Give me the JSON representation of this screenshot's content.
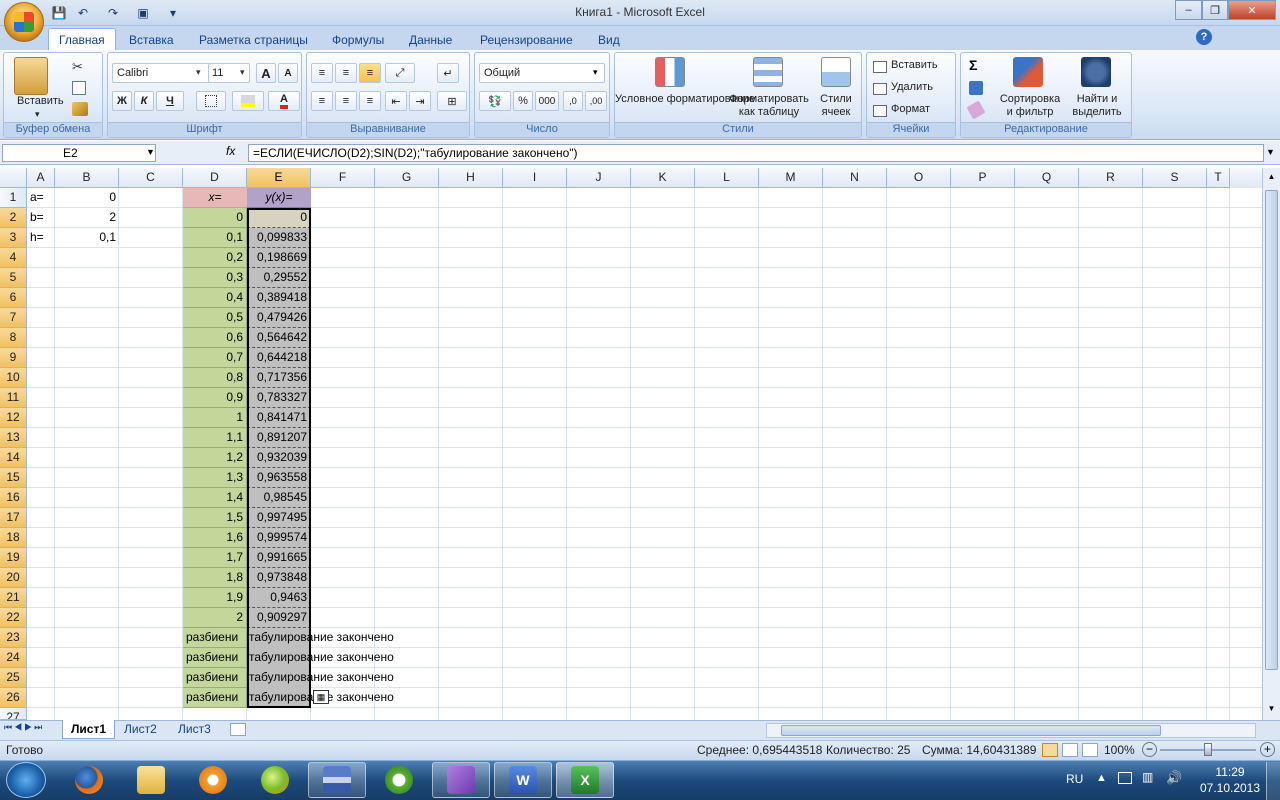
{
  "window": {
    "title": "Книга1 - Microsoft Excel",
    "min": "–",
    "restore": "❐",
    "close": "✕"
  },
  "qat": {
    "save": "💾",
    "undo": "↶",
    "redo": "↷",
    "preview": "▣",
    "dropdown": "▾"
  },
  "tabs": [
    "Главная",
    "Вставка",
    "Разметка страницы",
    "Формулы",
    "Данные",
    "Рецензирование",
    "Вид"
  ],
  "help": "?",
  "ribbon": {
    "clipboard": {
      "name": "Буфер обмена",
      "paste": "Вставить"
    },
    "font": {
      "name": "Шрифт",
      "family": "Calibri",
      "size": "11",
      "grow": "A",
      "shrink": "A",
      "bold": "Ж",
      "italic": "К",
      "underline": "Ч"
    },
    "alignment": {
      "name": "Выравнивание"
    },
    "number": {
      "name": "Число",
      "format": "Общий",
      "percent": "%",
      "thousands": "000",
      "incdec": ",0",
      "decdec": ",00"
    },
    "styles": {
      "name": "Стили",
      "conditional": "Условное форматирование",
      "as_table": "Форматировать как таблицу",
      "cell_styles": "Стили ячеек"
    },
    "cells": {
      "name": "Ячейки",
      "insert": "Вставить",
      "delete": "Удалить",
      "format": "Формат"
    },
    "editing": {
      "name": "Редактирование",
      "sum": "Σ",
      "sort": "Сортировка и фильтр",
      "find": "Найти и выделить"
    }
  },
  "formula_bar": {
    "name_box": "E2",
    "fx": "fx",
    "formula": "=ЕСЛИ(ЕЧИСЛО(D2);SIN(D2);\"табулирование закончено\")"
  },
  "columns": [
    "A",
    "B",
    "C",
    "D",
    "E",
    "F",
    "G",
    "H",
    "I",
    "J",
    "K",
    "L",
    "M",
    "N",
    "O",
    "P",
    "Q",
    "R",
    "S",
    "T"
  ],
  "rows": [
    "1",
    "2",
    "3",
    "4",
    "5",
    "6",
    "7",
    "8",
    "9",
    "10",
    "11",
    "12",
    "13",
    "14",
    "15",
    "16",
    "17",
    "18",
    "19",
    "20",
    "21",
    "22",
    "23",
    "24",
    "25",
    "26",
    "27"
  ],
  "cells": {
    "A": [
      "a=",
      "b=",
      "h="
    ],
    "B": [
      "0",
      "2",
      "0,1"
    ],
    "D1": "x=",
    "E1": "y(x)=",
    "D": [
      "0",
      "0,1",
      "0,2",
      "0,3",
      "0,4",
      "0,5",
      "0,6",
      "0,7",
      "0,8",
      "0,9",
      "1",
      "1,1",
      "1,2",
      "1,3",
      "1,4",
      "1,5",
      "1,6",
      "1,7",
      "1,8",
      "1,9",
      "2"
    ],
    "E": [
      "0",
      "0,099833",
      "0,198669",
      "0,29552",
      "0,389418",
      "0,479426",
      "0,564642",
      "0,644218",
      "0,717356",
      "0,783327",
      "0,841471",
      "0,891207",
      "0,932039",
      "0,963558",
      "0,98545",
      "0,997495",
      "0,999574",
      "0,991665",
      "0,973848",
      "0,9463",
      "0,909297"
    ],
    "D_text": [
      "разбиени",
      "разбиени",
      "разбиени",
      "разбиени"
    ],
    "E_text": [
      "табулирование закончено",
      "табулирование закончено",
      "табулирование закончено",
      "табулирование закончено"
    ]
  },
  "colors": {
    "header_d": "#e6b9b8",
    "header_e": "#b3a2c7",
    "col_d": "#c4d79b",
    "col_e": "#bfbfbf"
  },
  "sheets": [
    "Лист1",
    "Лист2",
    "Лист3"
  ],
  "status": {
    "ready": "Готово",
    "average": "Среднее: 0,695443518",
    "count": "Количество: 25",
    "sum": "Сумма: 14,60431389",
    "zoom": "100%"
  },
  "taskbar": {
    "lang": "RU",
    "time": "11:29",
    "date": "07.10.2013"
  }
}
